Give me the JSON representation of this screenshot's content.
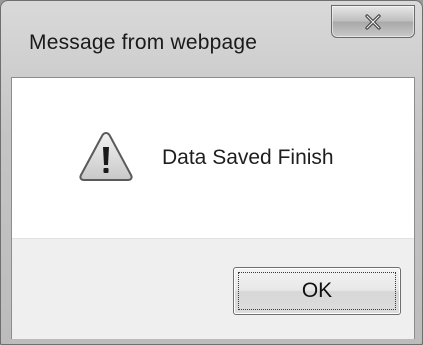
{
  "dialog": {
    "title": "Message from webpage",
    "message": "Data Saved Finish",
    "icon": "warning-icon",
    "close_label": "x",
    "ok_label": "OK"
  },
  "colors": {
    "frame": "#c4c4c4",
    "client_background": "#ffffff",
    "button_area_background": "#efefef",
    "text": "#1a1a1a"
  }
}
